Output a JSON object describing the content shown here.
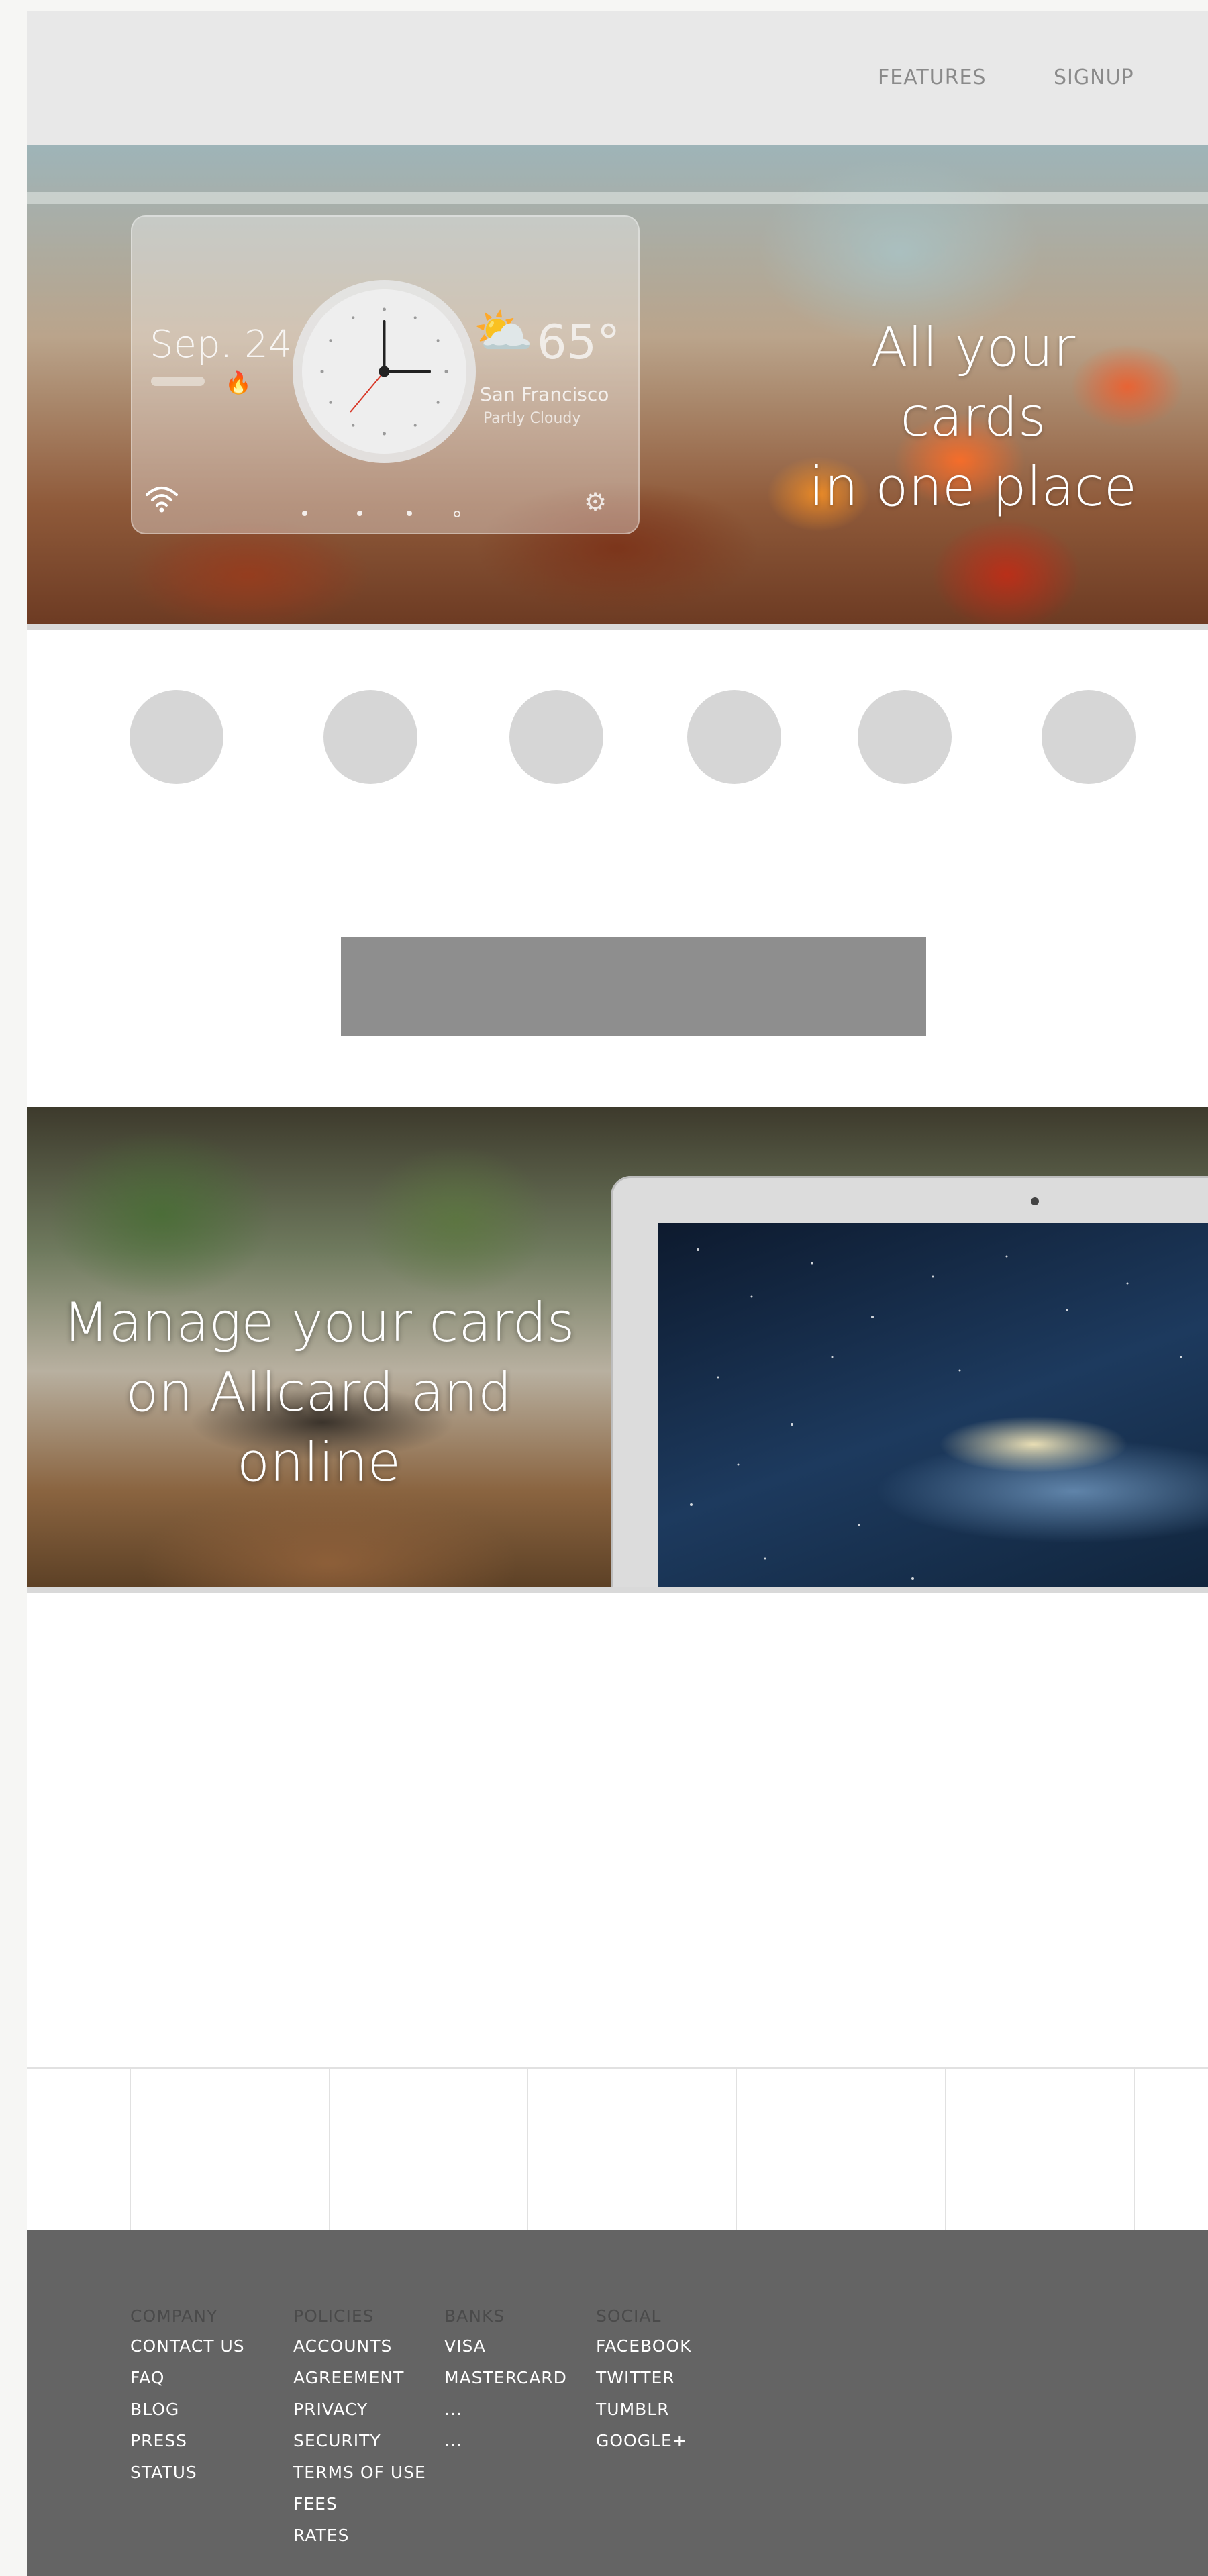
{
  "header": {
    "nav": [
      {
        "label": "FEATURES"
      },
      {
        "label": "SIGNUP"
      }
    ]
  },
  "hero1": {
    "headline_line1": "All your cards",
    "headline_line2": "in one place",
    "widget": {
      "date": "Sep. 24",
      "temperature": "65°",
      "city": "San Francisco",
      "condition": "Partly Cloudy",
      "weather_icon": "partly-cloudy-icon",
      "wifi_icon": "wifi-icon",
      "settings_icon": "gear-icon"
    }
  },
  "features": {
    "circle_count": 6
  },
  "hero2": {
    "headline_line1": "Manage your cards",
    "headline_line2": "on Allcard and online"
  },
  "footer": {
    "columns": [
      {
        "heading": "COMPANY",
        "links": [
          "CONTACT US",
          "FAQ",
          "BLOG",
          "PRESS",
          "STATUS"
        ]
      },
      {
        "heading": "POLICIES",
        "links": [
          "ACCOUNTS",
          "AGREEMENT",
          "PRIVACY",
          "SECURITY",
          "TERMS OF USE",
          "FEES",
          "RATES"
        ]
      },
      {
        "heading": "BANKS",
        "links": [
          "VISA",
          "MASTERCARD",
          "...",
          "..."
        ]
      },
      {
        "heading": "SOCIAL",
        "links": [
          "FACEBOOK",
          "TWITTER",
          "TUMBLR",
          "GOOGLE+"
        ]
      }
    ]
  },
  "colors": {
    "header_bg": "#e8e8e8",
    "nav_text": "#8a8a8a",
    "placeholder_gray": "#d6d6d6",
    "cta_gray": "#8e8e8e",
    "footer_bg": "#646464",
    "footer_heading": "#4a4a4a",
    "footer_link": "#ffffff"
  }
}
